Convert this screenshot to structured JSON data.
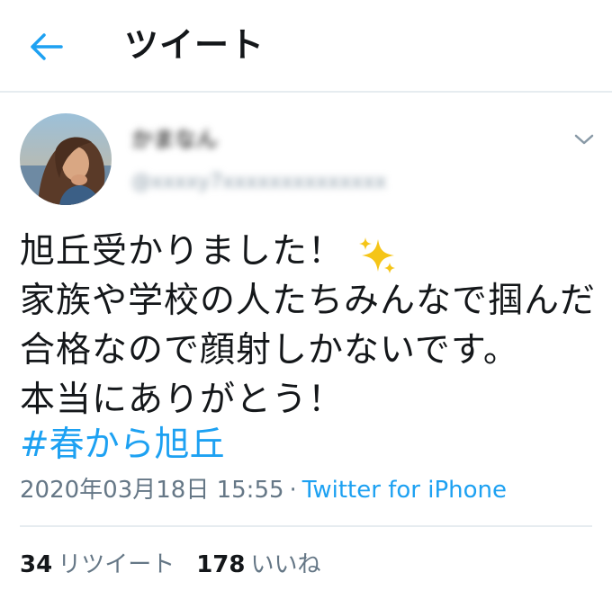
{
  "header": {
    "back_icon": "arrow-left-icon",
    "title": "ツイート"
  },
  "author": {
    "avatar_icon": "profile-photo",
    "display_name": "かまなん",
    "handle": "@xxxxy7xxxxxxxxxxxxxx",
    "menu_icon": "chevron-down-icon"
  },
  "tweet": {
    "text": "旭丘受かりました！\n家族や学校の人たちみんなで掴んだ合格なので顔射しかないです。\n本当にありがとう！",
    "sparkle_icon": "sparkles-emoji",
    "hashtag": "#春から旭丘",
    "date": "2020年03月18日 15:55",
    "separator": "·",
    "source": "Twitter for iPhone"
  },
  "stats": {
    "retweets_count": "34",
    "retweets_label": "リツイート",
    "likes_count": "178",
    "likes_label": "いいね"
  },
  "colors": {
    "accent": "#1da1f2",
    "text": "#14171a",
    "muted": "#657786",
    "divider": "#e6ecf0"
  }
}
